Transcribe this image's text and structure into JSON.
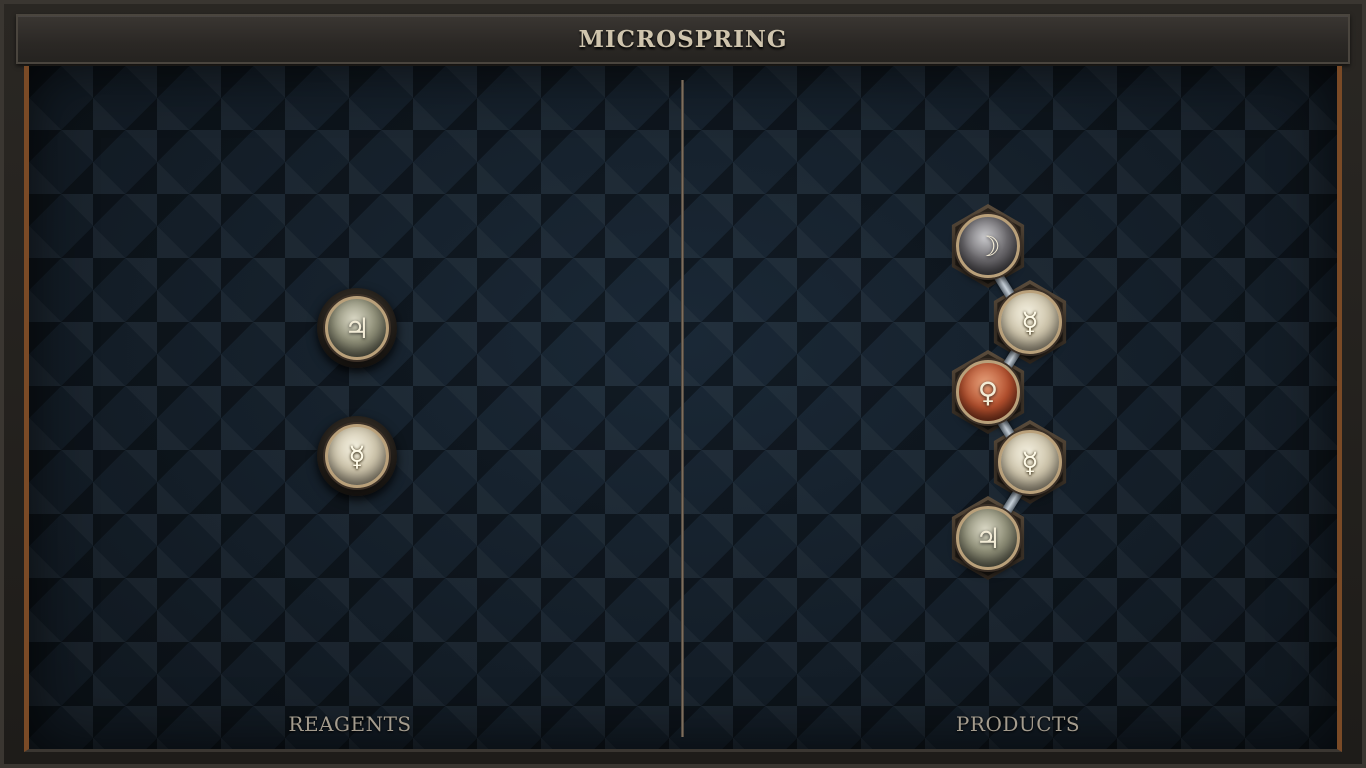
{
  "title": "MICROSPRING",
  "reagents": {
    "label": "REAGENTS",
    "atoms": [
      {
        "element": "tin",
        "symbol": "♃"
      },
      {
        "element": "quicksilver",
        "symbol": "☿"
      }
    ]
  },
  "products": {
    "label": "PRODUCTS",
    "atoms": [
      {
        "element": "silver",
        "symbol": "☽"
      },
      {
        "element": "quicksilver",
        "symbol": "☿"
      },
      {
        "element": "copper",
        "symbol": "♀"
      },
      {
        "element": "quicksilver",
        "symbol": "☿"
      },
      {
        "element": "tin",
        "symbol": "♃"
      }
    ]
  },
  "colors": {
    "board": "#131d28",
    "accent_frame": "#7a4a26",
    "title_text": "#cfc4ad",
    "label_text": "#a49c8e"
  }
}
